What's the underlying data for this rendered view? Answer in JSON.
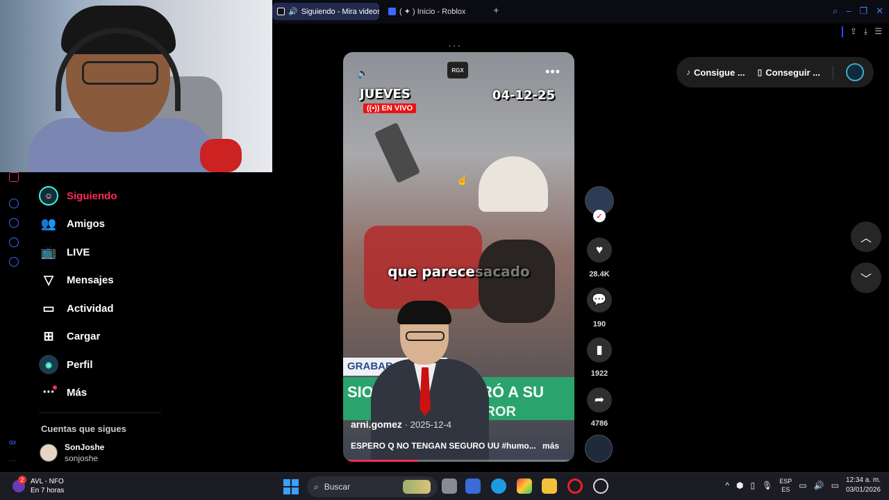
{
  "browser": {
    "tabs": [
      {
        "label": "Siguiendo - Mira videos",
        "active": true
      },
      {
        "label": "( ✦ ) Inicio - Roblox",
        "active": false
      }
    ],
    "new_tab": "+"
  },
  "sidebar": {
    "items": [
      {
        "label": "Siguiendo",
        "active": true
      },
      {
        "label": "Amigos"
      },
      {
        "label": "LIVE"
      },
      {
        "label": "Mensajes"
      },
      {
        "label": "Actividad"
      },
      {
        "label": "Cargar"
      },
      {
        "label": "Perfil"
      },
      {
        "label": "Más"
      }
    ],
    "following_heading": "Cuentas que sigues",
    "following": [
      {
        "name": "SonJoshe",
        "handle": "sonjoshe"
      }
    ],
    "strip_text": "ɑx"
  },
  "video": {
    "badge": "RGX",
    "day": "JUEVES",
    "live": "((•)) EN VIVO",
    "date": "04-12-25",
    "subtitle_main": "que parece",
    "subtitle_fade": "sacado",
    "banner_top": "GRABABA",
    "banner_main": "SIO",
    "banner_main2": "PARÓ A SU",
    "banner_main3": "RROR",
    "author": "arni.gomez",
    "post_date": "2025-12-4",
    "caption": "ESPERO Q NO TENGAN SEGURO UU #humo...",
    "more_link": "más",
    "progress": 0.32
  },
  "rail": {
    "likes": "28.4K",
    "comments": "190",
    "saves": "1922",
    "shares": "4786"
  },
  "top_right": {
    "item1": "Consigue ...",
    "item2": "Conseguir ..."
  },
  "taskbar": {
    "weather_title": "AVL - NFO",
    "weather_sub": "En 7 horas",
    "weather_badge": "2",
    "search_placeholder": "Buscar",
    "lang1": "ESP",
    "lang2": "ES",
    "time": "12:34 a. m.",
    "date": "03/01/2026"
  },
  "colors": {
    "accent": "#fe2c55",
    "taskbar": "#1c1c24"
  }
}
